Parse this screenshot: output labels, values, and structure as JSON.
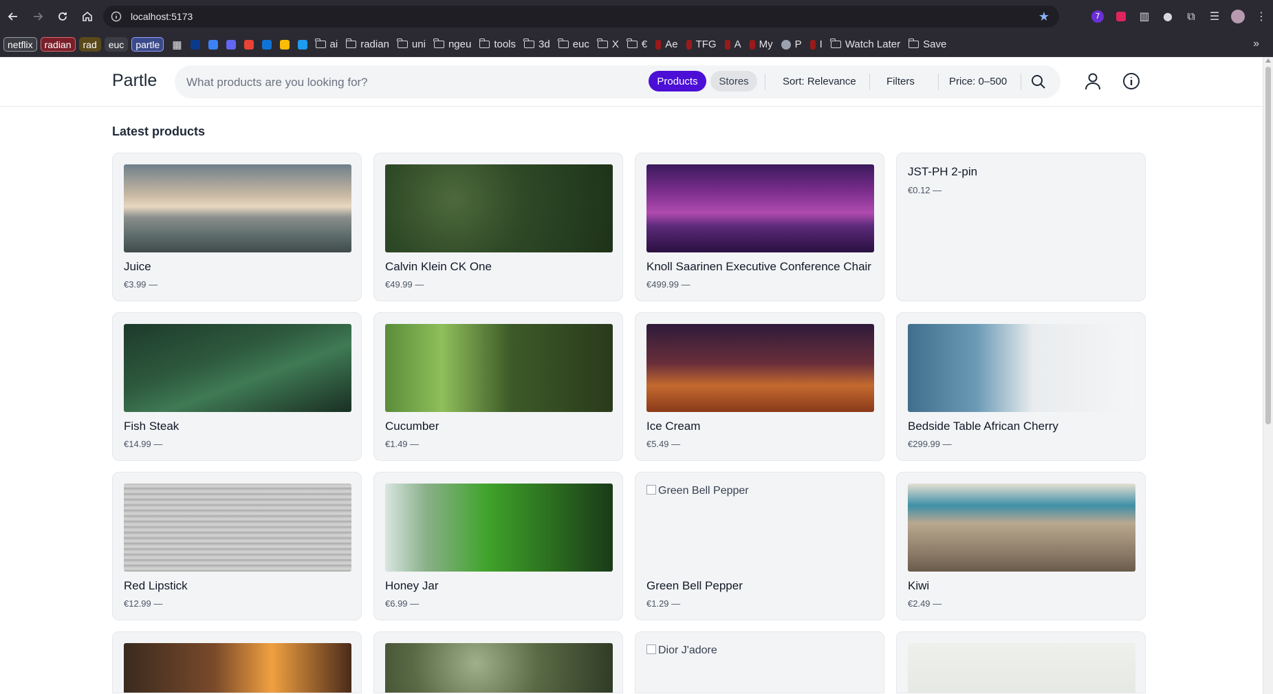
{
  "browser": {
    "url": "localhost:5173",
    "extension_badge": "7",
    "bookmark_tags": [
      {
        "label": "netflix",
        "color": "#3c3c44",
        "border": "#9aa0a6"
      },
      {
        "label": "radian",
        "color": "#7a1f2a",
        "border": "#e06a6a"
      },
      {
        "label": "rad",
        "color": "#5a4a1a",
        "border": "#5a4a1a"
      },
      {
        "label": "euc",
        "color": "#3c3c44",
        "border": "#3c3c44"
      },
      {
        "label": "partle",
        "color": "#3b4a8a",
        "border": "#9aa0ff"
      }
    ],
    "bookmarks": [
      {
        "label": "ai",
        "icon": "folder-icon"
      },
      {
        "label": "radian",
        "icon": "folder-icon"
      },
      {
        "label": "uni",
        "icon": "folder-icon"
      },
      {
        "label": "ngeu",
        "icon": "folder-icon"
      },
      {
        "label": "tools",
        "icon": "folder-icon"
      },
      {
        "label": "3d",
        "icon": "folder-icon"
      },
      {
        "label": "euc",
        "icon": "folder-icon"
      },
      {
        "label": "X",
        "icon": "folder-icon"
      },
      {
        "label": "€",
        "icon": "folder-icon"
      },
      {
        "label": "Ae",
        "icon": "bookmark-favicon"
      },
      {
        "label": "TFG",
        "icon": "bookmark-favicon"
      },
      {
        "label": "A",
        "icon": "bookmark-favicon"
      },
      {
        "label": "My",
        "icon": "bookmark-favicon"
      },
      {
        "label": "P",
        "icon": "globe-icon"
      },
      {
        "label": "I",
        "icon": "bookmark-favicon"
      },
      {
        "label": "Watch Later",
        "icon": "folder-icon"
      },
      {
        "label": "Save",
        "icon": "folder-icon"
      }
    ]
  },
  "header": {
    "brand": "Partle",
    "search_placeholder": "What products are you looking for?",
    "mode_products": "Products",
    "mode_stores": "Stores",
    "sort": "Sort: Relevance",
    "filters": "Filters",
    "price": "Price: 0–500",
    "accent_color": "#4b0fd6"
  },
  "main": {
    "section_title": "Latest products",
    "products": [
      {
        "name": "Juice",
        "price": "€3.99 —",
        "image": "img-sea"
      },
      {
        "name": "Calvin Klein CK One",
        "price": "€49.99 —",
        "image": "img-forest1"
      },
      {
        "name": "Knoll Saarinen Executive Conference Chair",
        "price": "€499.99 —",
        "image": "img-bridge"
      },
      {
        "name": "JST-PH 2-pin",
        "price": "€0.12 —",
        "image": ""
      },
      {
        "name": "Fish Steak",
        "price": "€14.99 —",
        "image": "img-river"
      },
      {
        "name": "Cucumber",
        "price": "€1.49 —",
        "image": "img-forest2"
      },
      {
        "name": "Ice Cream",
        "price": "€5.49 —",
        "image": "img-desert"
      },
      {
        "name": "Bedside Table African Cherry",
        "price": "€299.99 —",
        "image": "img-building"
      },
      {
        "name": "Red Lipstick",
        "price": "€12.99 —",
        "image": "img-stairs"
      },
      {
        "name": "Honey Jar",
        "price": "€6.99 —",
        "image": "img-waterfall"
      },
      {
        "name": "Green Bell Pepper",
        "price": "€1.29 —",
        "image": "broken",
        "alt": "Green Bell Pepper"
      },
      {
        "name": "Kiwi",
        "price": "€2.49 —",
        "image": "img-pier"
      }
    ],
    "partial_products": [
      {
        "image": "img-city"
      },
      {
        "image": "img-bokeh"
      },
      {
        "image": "broken",
        "alt": "Dior J'adore"
      },
      {
        "image": "img-pale"
      }
    ]
  }
}
